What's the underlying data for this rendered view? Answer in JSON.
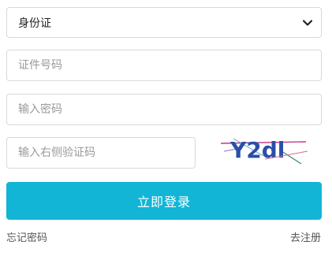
{
  "form": {
    "id_type": {
      "selected": "身份证"
    },
    "id_number": {
      "placeholder": "证件号码",
      "value": ""
    },
    "password": {
      "placeholder": "输入密码",
      "value": ""
    },
    "captcha": {
      "placeholder": "输入右侧验证码",
      "value": "",
      "image_text": "Y2dl"
    },
    "submit_label": "立即登录"
  },
  "links": {
    "forgot_password": "忘记密码",
    "register": "去注册"
  },
  "colors": {
    "primary": "#12b5d6",
    "border": "#d9d9d9",
    "captcha_text": "#2a4fa8"
  },
  "icons": {
    "select_arrow": "chevron-down-icon"
  }
}
